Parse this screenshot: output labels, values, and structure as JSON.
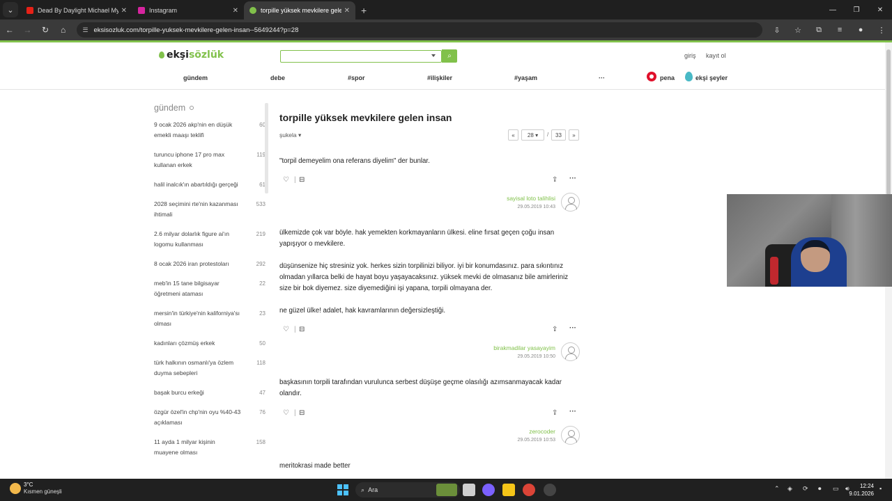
{
  "browser": {
    "tabs": [
      {
        "title": "Dead By Daylight Michael Myers",
        "color": "#e62117"
      },
      {
        "title": "Instagram",
        "color": "#d6249f"
      },
      {
        "title": "torpille yüksek mevkilere gelen",
        "color": "#81c14b"
      }
    ],
    "url": "eksisozluk.com/torpille-yuksek-mevkilere-gelen-insan--5649244?p=28"
  },
  "site": {
    "logo_part1": "ekşi",
    "logo_part2": "sözlük",
    "login": "giriş",
    "register": "kayıt ol",
    "nav": [
      "gündem",
      "debe",
      "#spor",
      "#ilişkiler",
      "#yaşam",
      "···"
    ],
    "pena": "pena",
    "eksi_seyler": "ekşi şeyler"
  },
  "sidebar": {
    "title": "gündem",
    "items": [
      {
        "title": "9 ocak 2026 akp'nin en düşük emekli maaşı teklifi",
        "count": "60"
      },
      {
        "title": "turuncu iphone 17 pro max kullanan erkek",
        "count": "119"
      },
      {
        "title": "halil inalcık'ın abartıldığı gerçeği",
        "count": "61"
      },
      {
        "title": "2028 seçimini rte'nin kazanması ihtimali",
        "count": "533"
      },
      {
        "title": "2.6 milyar dolarlık figure ai'ın logomu kullanması",
        "count": "219"
      },
      {
        "title": "8 ocak 2026 iran protestoları",
        "count": "292"
      },
      {
        "title": "meb'in 15 tane bilgisayar öğretmeni ataması",
        "count": "22"
      },
      {
        "title": "mersin'in türkiye'nin kaliforniya'sı olması",
        "count": "23"
      },
      {
        "title": "kadınları çözmüş erkek",
        "count": "50"
      },
      {
        "title": "türk halkının osmanlı'ya özlem duyma sebepleri",
        "count": "118"
      },
      {
        "title": "başak burcu erkeği",
        "count": "47"
      },
      {
        "title": "özgür özel'in chp'nin oyu %40-43 açıklaması",
        "count": "76"
      },
      {
        "title": "11 ayda 1 milyar kişinin muayene olması",
        "count": "158"
      }
    ]
  },
  "topic": {
    "title": "torpille yüksek mevkilere gelen insan",
    "sort": "şukela",
    "pager": {
      "prev": "«",
      "current": "28",
      "sep": "/",
      "total": "33",
      "next": "»"
    }
  },
  "entries": [
    {
      "paragraphs": [
        "\"torpil demeyelim ona referans diyelim\" der bunlar."
      ],
      "author": "sayisal loto talihlisi",
      "date": "29.05.2019 10:43"
    },
    {
      "paragraphs": [
        "ülkemizde çok var böyle. hak yemekten korkmayanların ülkesi. eline fırsat geçen çoğu insan yapışıyor o mevkilere.",
        "düşünsenize hiç stresiniz yok. herkes sizin torpilinizi biliyor. iyi bir konumdasınız. para sıkıntınız olmadan yıllarca belki de hayat boyu yaşayacaksınız. yüksek mevki de olmasanız bile amirleriniz size bir bok diyemez. size diyemediğini işi yapana, torpili olmayana der.",
        "ne güzel ülke! adalet, hak kavramlarının değersizleştiği."
      ],
      "author": "birakmadilar yasayayim",
      "date": "29.05.2019 10:50"
    },
    {
      "paragraphs": [
        "başkasının torpili tarafından vurulunca serbest düşüşe geçme olasılığı azımsanmayacak kadar olandır."
      ],
      "author": "zerocoder",
      "date": "29.05.2019 10:53"
    },
    {
      "paragraphs": [
        "meritokrasi made better"
      ]
    }
  ],
  "taskbar": {
    "temp": "3°C",
    "weather": "Kısmen güneşli",
    "search": "Ara",
    "time": "12:24",
    "date": "9.01.2026"
  },
  "icons": {
    "like": "heart-icon",
    "dislike": "minus-icon",
    "share": "share-icon",
    "more": "ellipsis-icon"
  },
  "colors": {
    "brand": "#81c14b",
    "pena": "#e0102b",
    "eksi_seyler": "#49b9c6"
  }
}
